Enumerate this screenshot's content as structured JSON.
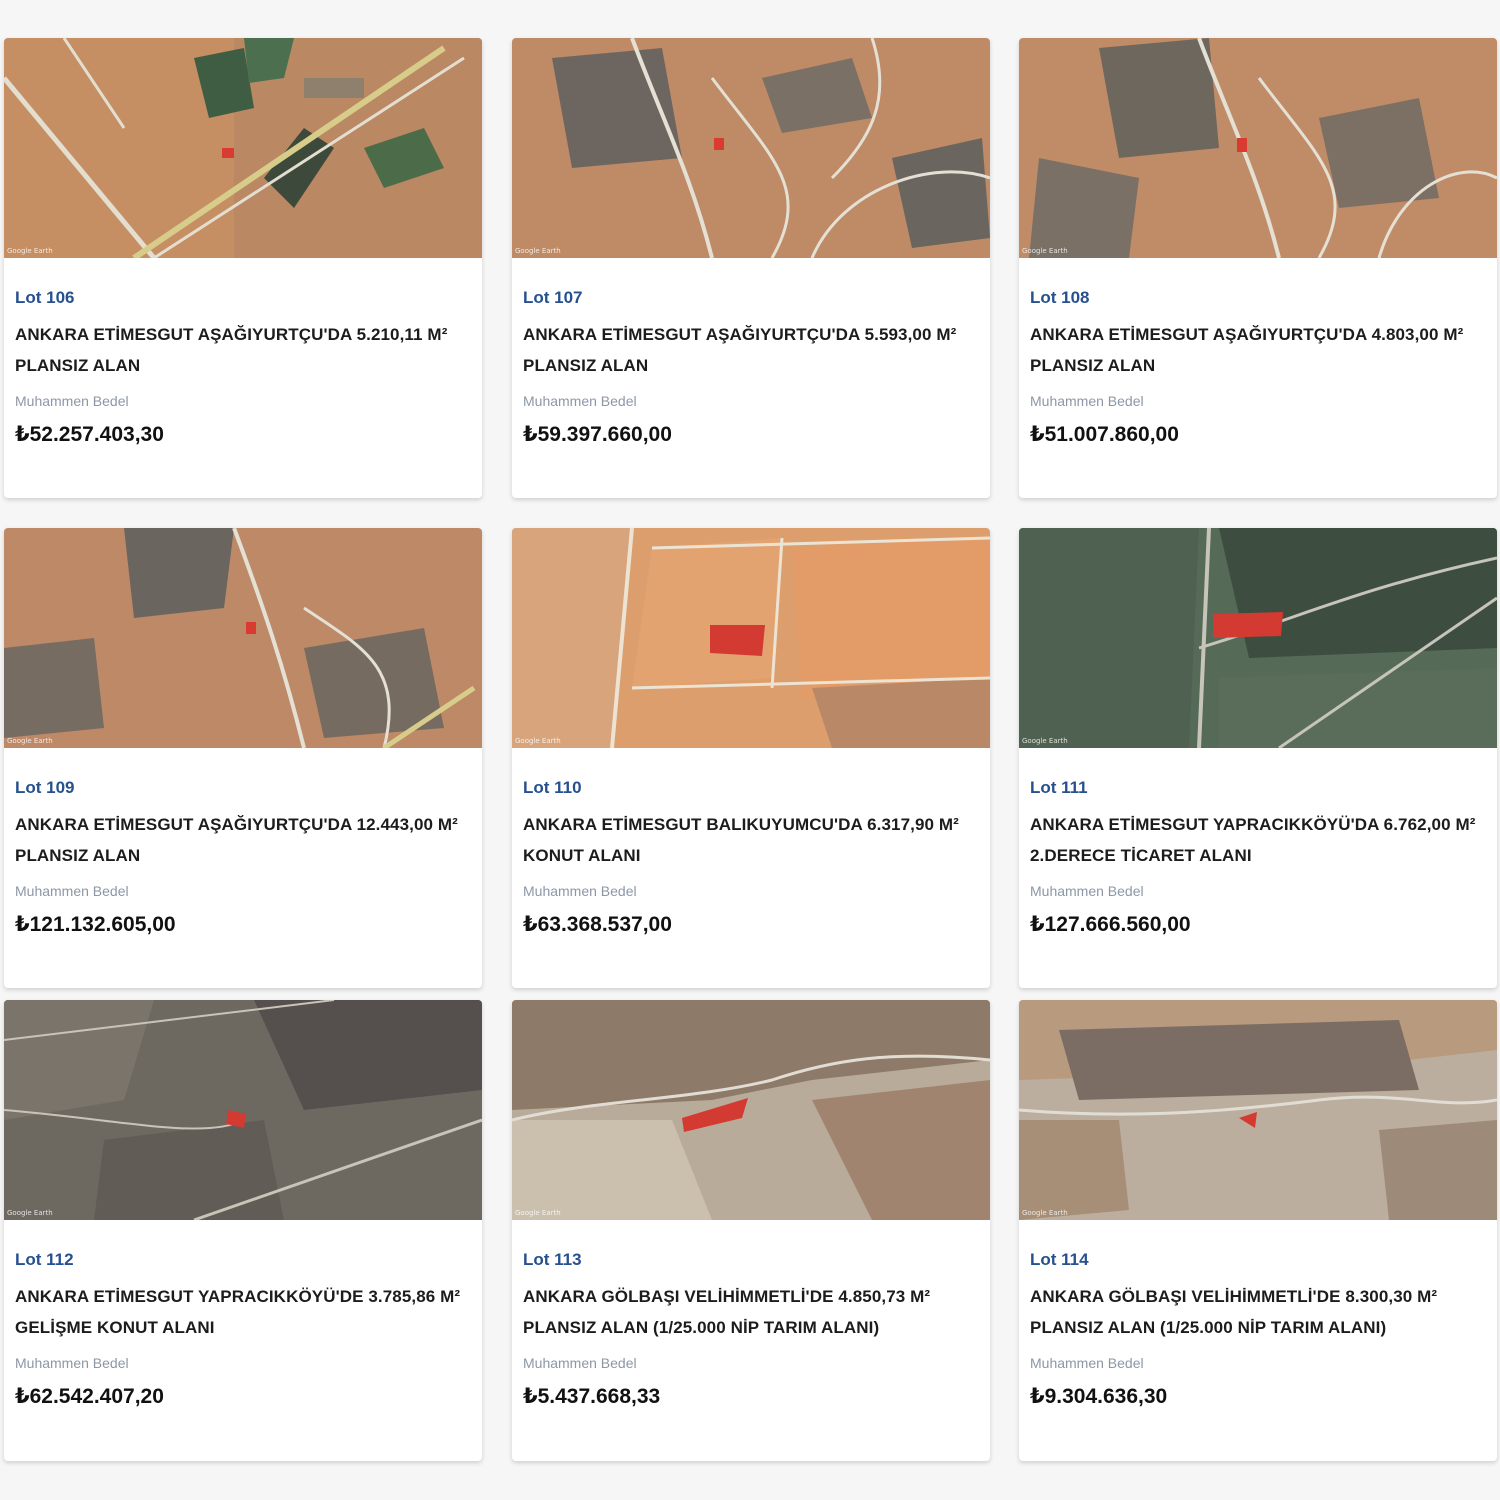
{
  "listing": {
    "lots": [
      {
        "lot": "Lot 106",
        "title_line1": "ANKARA ETİMESGUT AŞAĞIYURTÇU'DA 5.210,11 M²",
        "title_line2": "PLANSIZ ALAN",
        "price_label": "Muhammen Bedel",
        "price": "₺52.257.403,30",
        "watermark": "Google Earth",
        "image_colors": {
          "base": "#c58e63",
          "accent": "#3f5d43",
          "road": "#e3ded0",
          "parcel": "#d93b33"
        }
      },
      {
        "lot": "Lot 107",
        "title_line1": "ANKARA ETİMESGUT AŞAĞIYURTÇU'DA 5.593,00 M²",
        "title_line2": "PLANSIZ ALAN",
        "price_label": "Muhammen Bedel",
        "price": "₺59.397.660,00",
        "watermark": "Google Earth",
        "image_colors": {
          "base": "#bf8a66",
          "accent": "#6d6660",
          "road": "#e4e0d4",
          "parcel": "#d93b33"
        }
      },
      {
        "lot": "Lot 108",
        "title_line1": "ANKARA ETİMESGUT AŞAĞIYURTÇU'DA 4.803,00 M²",
        "title_line2": "PLANSIZ ALAN",
        "price_label": "Muhammen Bedel",
        "price": "₺51.007.860,00",
        "watermark": "Google Earth",
        "image_colors": {
          "base": "#c08c67",
          "accent": "#6e675e",
          "road": "#e4e0d4",
          "parcel": "#d93b33"
        }
      },
      {
        "lot": "Lot 109",
        "title_line1": "ANKARA ETİMESGUT AŞAĞIYURTÇU'DA 12.443,00 M²",
        "title_line2": "PLANSIZ ALAN",
        "price_label": "Muhammen Bedel",
        "price": "₺121.132.605,00",
        "watermark": "Google Earth",
        "image_colors": {
          "base": "#bd8967",
          "accent": "#6a655f",
          "road": "#e4e0d4",
          "parcel": "#d93b33"
        }
      },
      {
        "lot": "Lot 110",
        "title_line1": "ANKARA ETİMESGUT BALIKUYUMCU'DA 6.317,90 M²",
        "title_line2": "KONUT ALANI",
        "price_label": "Muhammen Bedel",
        "price": "₺63.368.537,00",
        "watermark": "Google Earth",
        "image_colors": {
          "base": "#dd9e6d",
          "accent": "#b98866",
          "road": "#ece3d2",
          "parcel": "#d33a32"
        }
      },
      {
        "lot": "Lot 111",
        "title_line1": "ANKARA ETİMESGUT YAPRACIKKÖYÜ'DA 6.762,00 M²",
        "title_line2": "2.DERECE TİCARET ALANI",
        "price_label": "Muhammen Bedel",
        "price": "₺127.666.560,00",
        "watermark": "Google Earth",
        "image_colors": {
          "base": "#566a58",
          "accent": "#3d4d40",
          "road": "#c7c4ba",
          "parcel": "#d33a32"
        }
      },
      {
        "lot": "Lot 112",
        "title_line1": "ANKARA ETİMESGUT YAPRACIKKÖYÜ'DE 3.785,86 M²",
        "title_line2": "GELİŞME KONUT ALANI",
        "price_label": "Muhammen Bedel",
        "price": "₺62.542.407,20",
        "watermark": "Google Earth",
        "image_colors": {
          "base": "#6e6960",
          "accent": "#554f4e",
          "road": "#c9c4b8",
          "parcel": "#d33a32"
        }
      },
      {
        "lot": "Lot 113",
        "title_line1": "ANKARA GÖLBAŞI VELİHİMMETLİ'DE 4.850,73 M²",
        "title_line2": "PLANSIZ ALAN (1/25.000 NİP TARIM ALANI)",
        "price_label": "Muhammen Bedel",
        "price": "₺5.437.668,33",
        "watermark": "Google Earth",
        "image_colors": {
          "base": "#b9ab9a",
          "accent": "#8e7a68",
          "road": "#e2ddd4",
          "parcel": "#d33a32"
        }
      },
      {
        "lot": "Lot 114",
        "title_line1": "ANKARA GÖLBAŞI VELİHİMMETLİ'DE 8.300,30 M²",
        "title_line2": "PLANSIZ ALAN (1/25.000 NİP TARIM ALANI)",
        "price_label": "Muhammen Bedel",
        "price": "₺9.304.636,30",
        "watermark": "Google Earth",
        "image_colors": {
          "base": "#bcae9e",
          "accent": "#7b6d63",
          "road": "#e2ddd4",
          "parcel": "#d33a32"
        }
      }
    ]
  },
  "colors": {
    "page_bg": "#f6f6f7",
    "card_bg": "#ffffff",
    "lot_text": "#27508f",
    "title_text": "#1c1c1c",
    "label_text": "#8c97a6",
    "price_text": "#111111"
  }
}
